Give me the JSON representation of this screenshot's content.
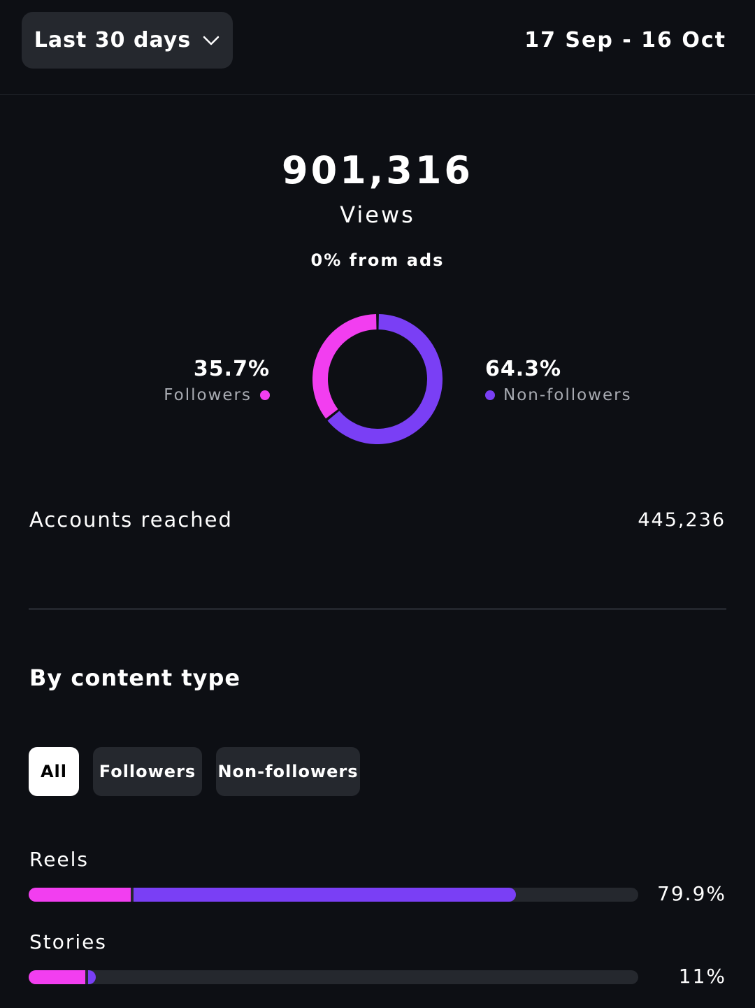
{
  "header": {
    "range_label": "Last 30 days",
    "date_range": "17 Sep - 16 Oct"
  },
  "summary": {
    "total": "901,316",
    "metric": "Views",
    "ads_note": "0% from ads"
  },
  "audience": {
    "followers": {
      "pct": "35.7%",
      "label": "Followers",
      "value": 35.7
    },
    "non_followers": {
      "pct": "64.3%",
      "label": "Non-followers",
      "value": 64.3
    }
  },
  "reach": {
    "label": "Accounts reached",
    "value": "445,236"
  },
  "content_type": {
    "title": "By content type",
    "tabs": [
      {
        "label": "All",
        "active": true
      },
      {
        "label": "Followers",
        "active": false
      },
      {
        "label": "Non-followers",
        "active": false
      }
    ],
    "rows": [
      {
        "label": "Reels",
        "pct": "79.9%",
        "followers_share": 16.8,
        "non_followers_share": 63.1
      },
      {
        "label": "Stories",
        "pct": "11%",
        "followers_share": 9.3,
        "non_followers_share": 1.7
      }
    ]
  },
  "colors": {
    "followers": "#f23ef0",
    "non_followers": "#7a3ff5",
    "track": "#25282e",
    "background": "#0d0f14"
  }
}
